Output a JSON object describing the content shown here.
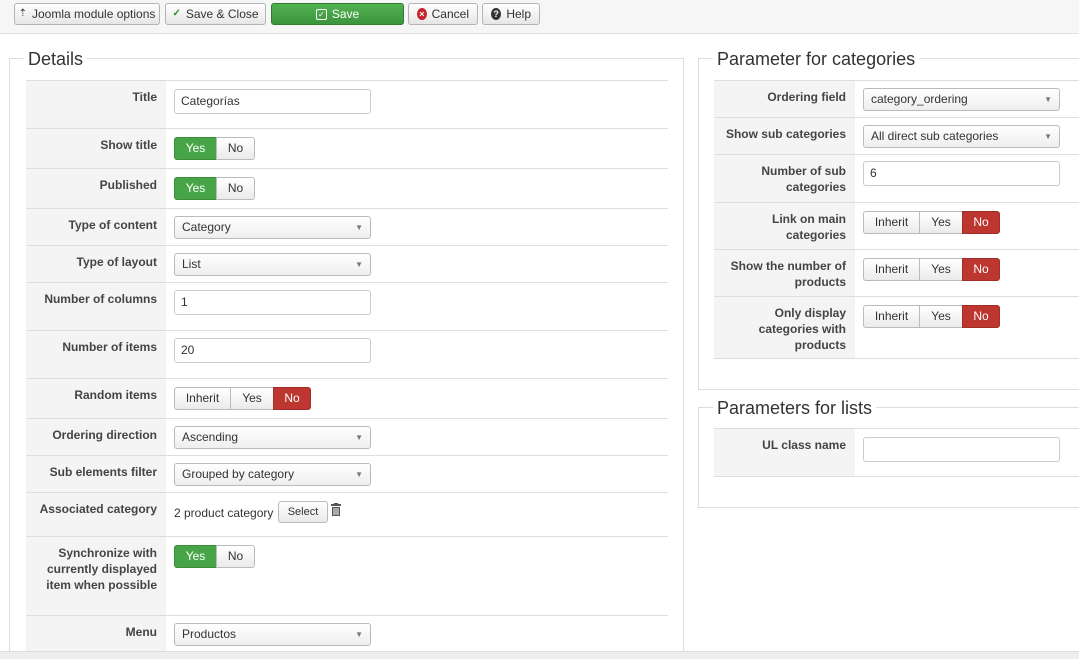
{
  "toolbar": {
    "module_options": "Joomla module options",
    "save_close": "Save & Close",
    "save": "Save",
    "cancel": "Cancel",
    "help": "Help"
  },
  "details": {
    "legend": "Details",
    "title_label": "Title",
    "title_value": "Categorías",
    "show_title_label": "Show title",
    "published_label": "Published",
    "type_content_label": "Type of content",
    "type_content_value": "Category",
    "type_layout_label": "Type of layout",
    "type_layout_value": "List",
    "num_columns_label": "Number of columns",
    "num_columns_value": "1",
    "num_items_label": "Number of items",
    "num_items_value": "20",
    "random_items_label": "Random items",
    "ordering_direction_label": "Ordering direction",
    "ordering_direction_value": "Ascending",
    "sub_filter_label": "Sub elements filter",
    "sub_filter_value": "Grouped by category",
    "assoc_category_label": "Associated category",
    "assoc_category_value": "2 product category",
    "select_button": "Select",
    "sync_label": "Synchronize with currently displayed item when possible",
    "menu_label": "Menu",
    "menu_value": "Productos"
  },
  "toggles": {
    "yes": "Yes",
    "no": "No",
    "inherit": "Inherit"
  },
  "categories": {
    "legend": "Parameter for categories",
    "ordering_field_label": "Ordering field",
    "ordering_field_value": "category_ordering",
    "show_sub_label": "Show sub categories",
    "show_sub_value": "All direct sub categories",
    "num_sub_label": "Number of sub categories",
    "num_sub_value": "6",
    "link_main_label": "Link on main categories",
    "show_number_label": "Show the number of products",
    "only_display_label": "Only display categories with products"
  },
  "lists": {
    "legend": "Parameters for lists",
    "ul_class_label": "UL class name",
    "ul_class_value": ""
  },
  "colors": {
    "yes_active": "#46a546",
    "no_active": "#bd362f",
    "save_button": "#3c953c"
  }
}
